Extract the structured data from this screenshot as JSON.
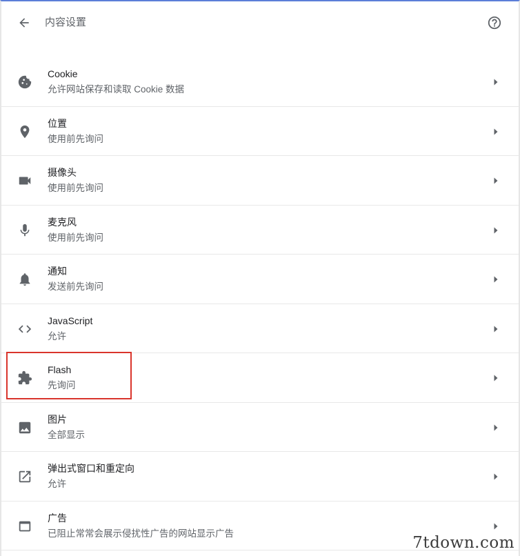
{
  "header": {
    "title": "内容设置"
  },
  "items": [
    {
      "title": "Cookie",
      "subtitle": "允许网站保存和读取 Cookie 数据",
      "icon": "cookie-icon"
    },
    {
      "title": "位置",
      "subtitle": "使用前先询问",
      "icon": "location-icon"
    },
    {
      "title": "摄像头",
      "subtitle": "使用前先询问",
      "icon": "camera-icon"
    },
    {
      "title": "麦克风",
      "subtitle": "使用前先询问",
      "icon": "microphone-icon"
    },
    {
      "title": "通知",
      "subtitle": "发送前先询问",
      "icon": "bell-icon"
    },
    {
      "title": "JavaScript",
      "subtitle": "允许",
      "icon": "code-icon"
    },
    {
      "title": "Flash",
      "subtitle": "先询问",
      "icon": "puzzle-icon"
    },
    {
      "title": "图片",
      "subtitle": "全部显示",
      "icon": "image-icon"
    },
    {
      "title": "弹出式窗口和重定向",
      "subtitle": "允许",
      "icon": "open-in-new-icon"
    },
    {
      "title": "广告",
      "subtitle": "已阻止常常会展示侵扰性广告的网站显示广告",
      "icon": "web-asset-icon"
    }
  ],
  "watermark": "7tdown.com",
  "colors": {
    "accent_top": "#5b7ed8",
    "highlight": "#d9342b",
    "icon": "#5f6368"
  }
}
